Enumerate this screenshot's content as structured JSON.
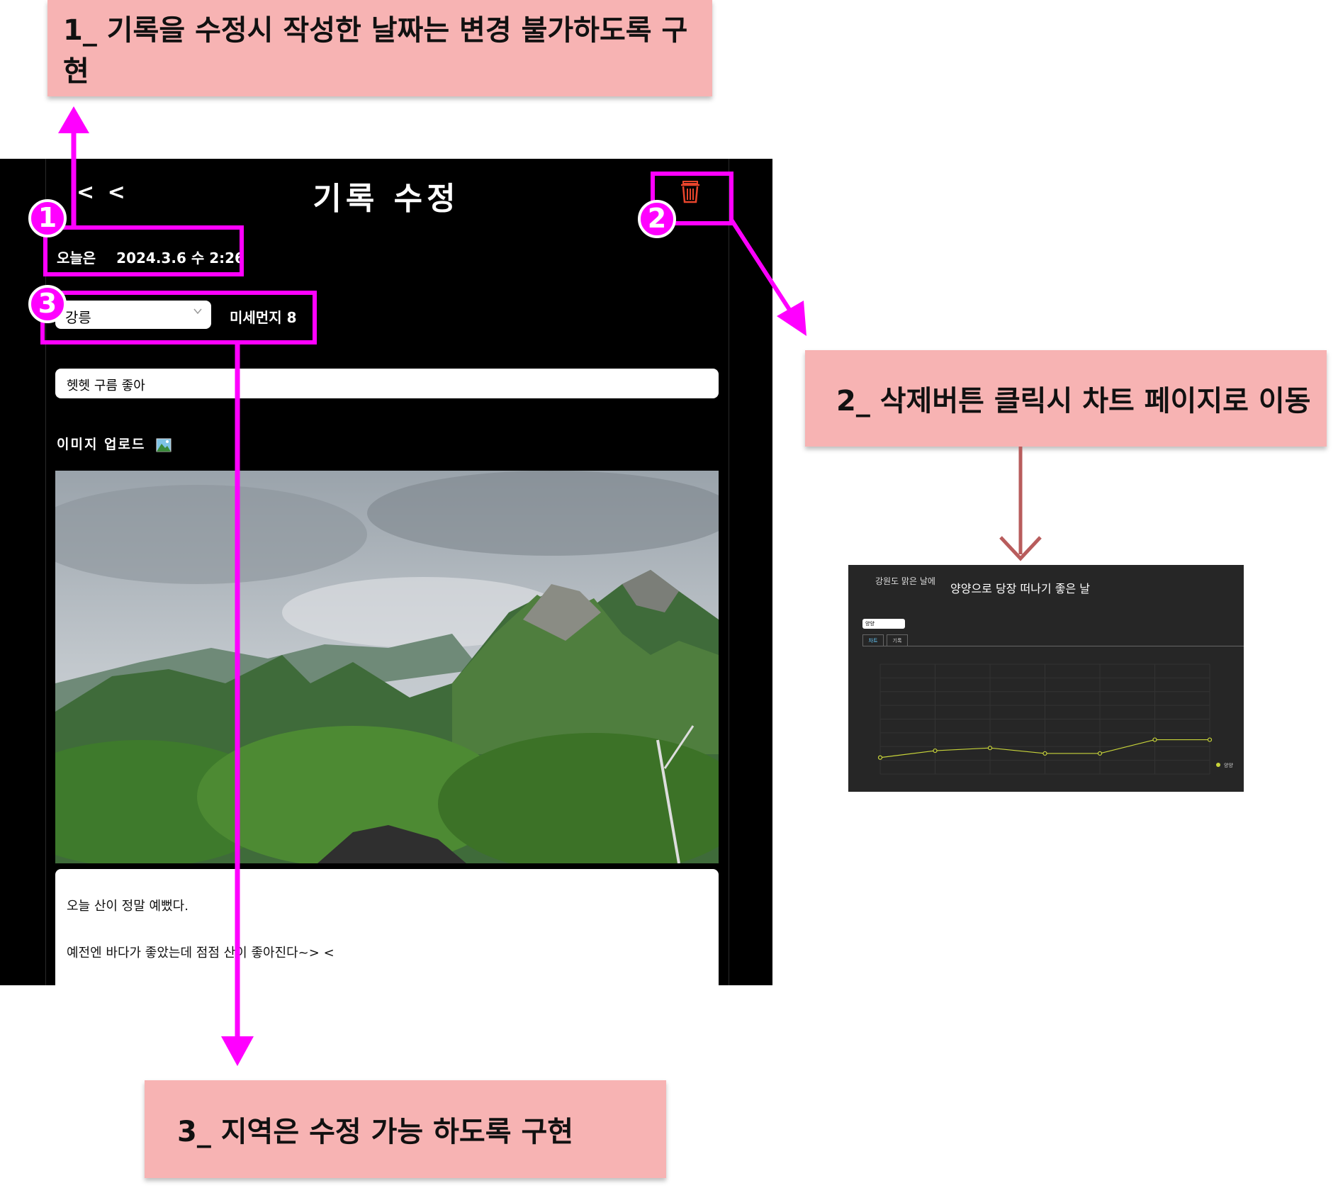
{
  "annotations": [
    {
      "number": "1",
      "text": "1_ 기록을 수정시 작성한 날짜는 변경 불가하도록 구현"
    },
    {
      "number": "2",
      "text": "2_ 삭제버튼 클릭시 차트 페이지로 이동"
    },
    {
      "number": "3",
      "text": "3_ 지역은 수정 가능 하도록 구현"
    }
  ],
  "app": {
    "back_label": "< <",
    "title": "기록 수정",
    "date_label": "오늘은",
    "date_value": "2024.3.6 수 2:26",
    "region": "강릉",
    "dust_label": "미세먼지 8",
    "record_title": "헷헷 구름 좋아",
    "upload_label": "이미지 업로드",
    "content_line1": "오늘 산이 정말 예뻤다.",
    "content_line2": "예전엔 바다가 좋았는데 점점 산이 좋아진다~> <",
    "delete_icon": "trash-icon",
    "delete_color": "#e8452c"
  },
  "chart_page": {
    "logo_text": "강원도 맑은 날에",
    "heading": "양양으로 당장 떠나기 좋은 날",
    "region": "양양",
    "tabs": [
      "차트",
      "기록"
    ],
    "legend": "양양"
  },
  "chart_data": {
    "type": "line",
    "categories": [
      "",
      "",
      "",
      "",
      "",
      "",
      ""
    ],
    "series": [
      {
        "name": "양양",
        "values": [
          12,
          17,
          19,
          15,
          15,
          25,
          25
        ]
      }
    ],
    "ylim": [
      0,
      80
    ],
    "grid": true,
    "line_color": "#c8d43a",
    "legend_position": "bottom-right"
  },
  "colors": {
    "highlight": "#ff00ff",
    "note_bg": "#f7b3b3",
    "arrow2": "#b85c5c"
  }
}
